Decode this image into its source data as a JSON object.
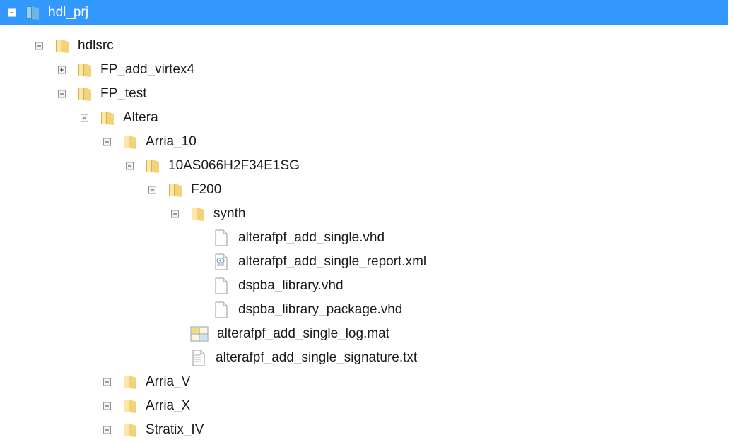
{
  "tree": {
    "rows": [
      {
        "label": "hdl_prj",
        "icon": "folder-icon",
        "expander": "expanded",
        "selected": true
      },
      {
        "label": "hdlsrc",
        "icon": "folder-icon",
        "expander": "expanded"
      },
      {
        "label": "FP_add_virtex4",
        "icon": "folder-icon",
        "expander": "collapsed"
      },
      {
        "label": "FP_test",
        "icon": "folder-icon",
        "expander": "expanded"
      },
      {
        "label": "Altera",
        "icon": "folder-icon",
        "expander": "expanded"
      },
      {
        "label": "Arria_10",
        "icon": "folder-icon",
        "expander": "expanded"
      },
      {
        "label": "10AS066H2F34E1SG",
        "icon": "folder-icon",
        "expander": "expanded"
      },
      {
        "label": "F200",
        "icon": "folder-icon",
        "expander": "expanded"
      },
      {
        "label": "synth",
        "icon": "folder-icon",
        "expander": "expanded"
      },
      {
        "label": "alterafpf_add_single.vhd",
        "icon": "file-icon",
        "expander": "none"
      },
      {
        "label": "alterafpf_add_single_report.xml",
        "icon": "xml-file-icon",
        "expander": "none"
      },
      {
        "label": "dspba_library.vhd",
        "icon": "file-icon",
        "expander": "none"
      },
      {
        "label": "dspba_library_package.vhd",
        "icon": "file-icon",
        "expander": "none"
      },
      {
        "label": "alterafpf_add_single_log.mat",
        "icon": "mat-file-icon",
        "expander": "none"
      },
      {
        "label": "alterafpf_add_single_signature.txt",
        "icon": "text-file-icon",
        "expander": "none"
      },
      {
        "label": "Arria_V",
        "icon": "folder-icon",
        "expander": "collapsed"
      },
      {
        "label": "Arria_X",
        "icon": "folder-icon",
        "expander": "collapsed"
      },
      {
        "label": "Stratix_IV",
        "icon": "folder-icon",
        "expander": "collapsed"
      }
    ]
  },
  "colors": {
    "selection": "#3399ff",
    "folder": "#e8c45c",
    "selected_folder": "#4aa8d8"
  }
}
